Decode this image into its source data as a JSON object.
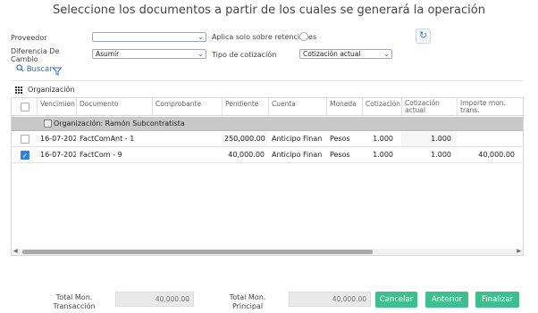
{
  "title": "Seleccione los documentos a partir de los cuales se generará la operación",
  "form": {
    "proveedor_label": "Proveedor",
    "proveedor_value": "",
    "retenciones_label": "Aplica solo sobre retenciones",
    "diferencia_label": "Diferencia De Cambio",
    "diferencia_value": "Asumir",
    "tipo_cotizacion_label": "Tipo de cotización",
    "tipo_cotizacion_value": "Cotización actual"
  },
  "toolbar": {
    "buscar_label": "Buscar",
    "search_icon": "search-icon",
    "filter_icon": "filter-icon"
  },
  "grouping": {
    "icon": "grid-icon",
    "label": "Organización"
  },
  "grid": {
    "columns": [
      "Vencimien",
      "Documento",
      "Comprobante",
      "Pendiente",
      "Cuenta",
      "Moneda",
      "Cotización",
      "Cotización actual",
      "Importe mon. trans."
    ],
    "group_label": "Organización: Ramón Subcontratista",
    "rows": [
      {
        "checked": false,
        "vencimiento": "16-07-202",
        "documento": "FactComAnt - 1",
        "comprobante": "",
        "pendiente": "250,000.00",
        "cuenta": "Anticipo Finan",
        "moneda": "Pesos",
        "cotizacion": "1.000",
        "cotizacion_actual": "1.000",
        "importe": ""
      },
      {
        "checked": true,
        "vencimiento": "16-07-202",
        "documento": "FactCom - 9",
        "comprobante": "",
        "pendiente": "40,000.00",
        "cuenta": "Anticipo Finan",
        "moneda": "Pesos",
        "cotizacion": "1.000",
        "cotizacion_actual": "1.000",
        "importe": "40,000.00"
      }
    ]
  },
  "footer": {
    "total_trans_label": "Total Mon. Transacción",
    "total_trans_value": "40,000.00",
    "total_principal_label": "Total Mon. Principal",
    "total_principal_value": "40,000.00",
    "cancel_label": "Cancelar",
    "previous_label": "Anterior",
    "finish_label": "Finalizar"
  },
  "colors": {
    "accent": "#2f80ed",
    "button": "#3fbf8f",
    "group_row": "#c8c8c8"
  }
}
